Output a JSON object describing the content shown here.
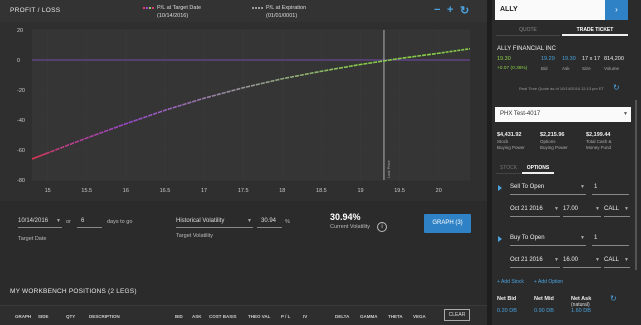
{
  "header": {
    "title": "PROFIT / LOSS",
    "legend_target_label": "P/L at Target Date",
    "legend_target_date": "(10/14/2016)",
    "legend_exp_label": "P/L at Expiration",
    "legend_exp_date": "(01/01/0001)"
  },
  "icons": {
    "zoom_out": "minus-icon",
    "zoom_in": "plus-icon",
    "refresh": "refresh-icon"
  },
  "chart_data": {
    "type": "line",
    "y_ticks": [
      "20",
      "0",
      "-20",
      "-40",
      "-60",
      "-80"
    ],
    "x_ticks": [
      "15",
      "15.5",
      "16",
      "16.5",
      "17",
      "17.5",
      "18",
      "18.5",
      "19",
      "19.5",
      "20"
    ],
    "ylim": [
      -80,
      20
    ],
    "xlim": [
      14.8,
      20.4
    ],
    "last_price_label": "Last Price",
    "last_price": 19.3,
    "series": [
      {
        "x": [
          14.8,
          15.0,
          15.5,
          16.0,
          16.5,
          17.0,
          17.5,
          18.0,
          18.5,
          19.0,
          19.5,
          20.0,
          20.4
        ],
        "y": [
          -66,
          -62,
          -52,
          -42.5,
          -33.5,
          -25.5,
          -18.5,
          -12.5,
          -7.5,
          -3,
          1,
          4.5,
          7.5
        ]
      }
    ],
    "colors": {
      "low": "#e8344e",
      "mid": "#a24bd6",
      "gray": "#9a9a9a",
      "high": "#8bd04b",
      "zero": "#8a4fd1",
      "grid": "#3c3c3c"
    }
  },
  "controls": {
    "date_value": "10/14/2016",
    "or_label": "or",
    "days_value": "6",
    "days_label": "days to go",
    "target_date_label": "Target Date",
    "volatility_select": "Historical Volatility",
    "volatility_value": "30.94",
    "percent_label": "%",
    "target_volatility_label": "Target Volatility",
    "current_volatility_value": "30.94%",
    "current_volatility_label": "Current Volatility",
    "info_icon": "i",
    "graph_button": "GRAPH (3)"
  },
  "workbench": {
    "title": "MY WORKBENCH POSITIONS (2 LEGS)",
    "columns": [
      "GRAPH",
      "SIDE",
      "QTY",
      "DESCRIPTION",
      "BID",
      "ASK",
      "COST BASIS",
      "THEO VAL",
      "P / L",
      "IV",
      "DELTA",
      "GAMMA",
      "THETA",
      "VEGA"
    ],
    "clear_button": "CLEAR"
  },
  "ticket": {
    "symbol": "ALLY",
    "symbol_button": "›",
    "tab_quote": "QUOTE",
    "tab_trade": "TRADE TICKET",
    "company": "ALLY FINANCIAL INC",
    "last": "19.30",
    "change": "+0.07 (0.36%)",
    "bid": "19.29",
    "bid_label": "Bid",
    "ask": "19.30",
    "ask_label": "Ask",
    "size": "17 x 17",
    "size_label": "Size",
    "volume": "814,200",
    "volume_label": "Volume",
    "realtime": "Real Time Quote as of 10/14/2016 12:13 pm ET",
    "account": "PHX Test-4017",
    "stock_bp_value": "$4,431.92",
    "stock_bp_label1": "Stock",
    "stock_bp_label2": "Buying Power",
    "option_bp_value": "$2,215.96",
    "option_bp_label1": "Options",
    "option_bp_label2": "Buying Power",
    "cash_value": "$2,199.44",
    "cash_label1": "Total Cash &",
    "cash_label2": "Money Fund",
    "tab_stock": "STOCK",
    "tab_options": "OPTIONS",
    "leg1": {
      "action": "Sell To Open",
      "qty": "1",
      "expiry": "Oct 21 2016",
      "strike": "17.00",
      "type": "CALL"
    },
    "leg2": {
      "action": "Buy To Open",
      "qty": "1",
      "expiry": "Oct 21 2016",
      "strike": "16.00",
      "type": "CALL"
    },
    "add_stock": "+ Add Stock",
    "add_option": "+ Add Option",
    "net_bid_label": "Net Bid",
    "net_bid": "0.20 DB",
    "net_mid_label": "Net Mid",
    "net_mid": "0.90 DB",
    "net_ask_label": "Net Ask",
    "net_ask_sub": "(natural)",
    "net_ask": "1.60 DB"
  }
}
